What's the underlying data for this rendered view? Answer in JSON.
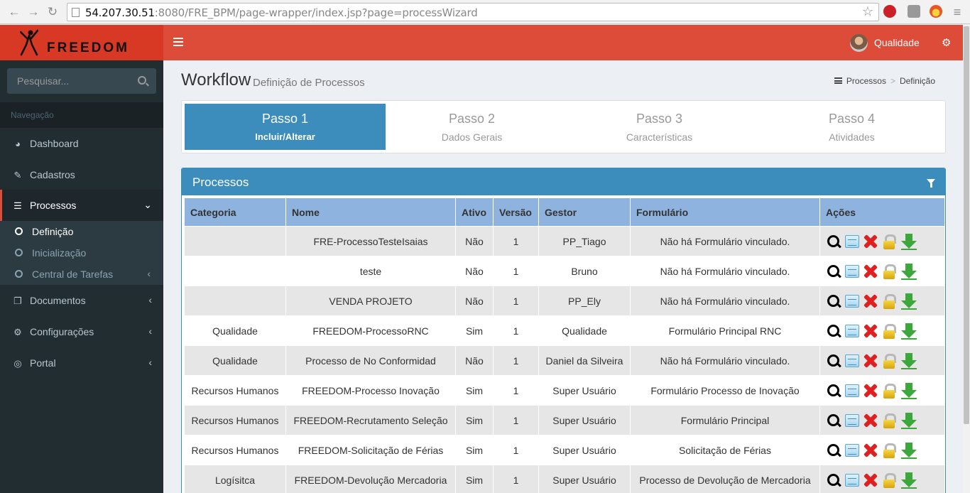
{
  "browser": {
    "url_host": "54.207.30.51",
    "url_rest": ":8080/FRE_BPM/page-wrapper/index.jsp?page=processWizard"
  },
  "header": {
    "logo_text": "FREEDOM",
    "user_name": "Qualidade"
  },
  "sidebar": {
    "search_placeholder": "Pesquisar...",
    "nav_header": "Navegação",
    "items": [
      {
        "label": "Dashboard"
      },
      {
        "label": "Cadastros"
      },
      {
        "label": "Processos"
      },
      {
        "label": "Documentos"
      },
      {
        "label": "Configurações"
      },
      {
        "label": "Portal"
      }
    ],
    "submenu": [
      {
        "label": "Definição"
      },
      {
        "label": "Inicialização"
      },
      {
        "label": "Central de Tarefas"
      }
    ]
  },
  "page": {
    "title": "Workflow",
    "subtitle": "Definição de Processos",
    "breadcrumb": [
      "Processos",
      "Definição"
    ]
  },
  "wizard": {
    "steps": [
      {
        "num": "Passo 1",
        "label": "Incluir/Alterar"
      },
      {
        "num": "Passo 2",
        "label": "Dados Gerais"
      },
      {
        "num": "Passo 3",
        "label": "Características"
      },
      {
        "num": "Passo 4",
        "label": "Atividades"
      }
    ]
  },
  "panel": {
    "title": "Processos"
  },
  "table": {
    "headers": [
      "Categoria",
      "Nome",
      "Ativo",
      "Versão",
      "Gestor",
      "Formulário",
      "Ações"
    ],
    "rows": [
      {
        "categoria": "",
        "nome": "FRE-ProcessoTesteIsaias",
        "ativo": "Não",
        "versao": "1",
        "gestor": "PP_Tiago",
        "formulario": "Não há Formulário vinculado."
      },
      {
        "categoria": "",
        "nome": "teste",
        "ativo": "Não",
        "versao": "1",
        "gestor": "Bruno",
        "formulario": "Não há Formulário vinculado."
      },
      {
        "categoria": "",
        "nome": "VENDA PROJETO",
        "ativo": "Não",
        "versao": "1",
        "gestor": "PP_Ely",
        "formulario": "Não há Formulário vinculado."
      },
      {
        "categoria": "Qualidade",
        "nome": "FREEDOM-ProcessoRNC",
        "ativo": "Sim",
        "versao": "1",
        "gestor": "Qualidade",
        "formulario": "Formulário Principal RNC"
      },
      {
        "categoria": "Qualidade",
        "nome": "Processo de No Conformidad",
        "ativo": "Não",
        "versao": "1",
        "gestor": "Daniel da Silveira",
        "formulario": "Não há Formulário vinculado."
      },
      {
        "categoria": "Recursos Humanos",
        "nome": "FREEDOM-Processo Inovação",
        "ativo": "Sim",
        "versao": "1",
        "gestor": "Super Usuário",
        "formulario": "Formulário Processo de Inovação"
      },
      {
        "categoria": "Recursos Humanos",
        "nome": "FREEDOM-Recrutamento Seleção",
        "ativo": "Sim",
        "versao": "1",
        "gestor": "Super Usuário",
        "formulario": "Formulário Principal"
      },
      {
        "categoria": "Recursos Humanos",
        "nome": "FREEDOM-Solicitação de Férias",
        "ativo": "Sim",
        "versao": "1",
        "gestor": "Super Usuário",
        "formulario": "Solicitação de Férias"
      },
      {
        "categoria": "Logísitca",
        "nome": "FREEDOM-Devolução Mercadoria",
        "ativo": "Sim",
        "versao": "1",
        "gestor": "Super Usuário",
        "formulario": "Processo de Devolução de Mercadoria"
      }
    ],
    "actions": [
      "search-icon",
      "edit-icon",
      "delete-icon",
      "lock-icon",
      "download-icon"
    ]
  },
  "colors": {
    "header_red": "#dd4b39",
    "logo_red": "#d73925",
    "sidebar_dark": "#222d32",
    "primary_blue": "#3c8dbc",
    "table_header": "#8db3de"
  }
}
